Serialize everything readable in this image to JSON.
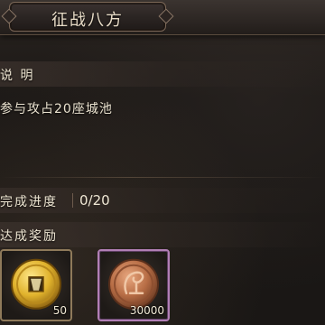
{
  "panel": {
    "title": "征战八方"
  },
  "section_desc": {
    "label": "说 明",
    "text": "参与攻占20座城池"
  },
  "progress": {
    "label": "完成进度",
    "value": "0/20"
  },
  "rewards": {
    "label": "达成奖励",
    "items": [
      {
        "icon": "gold-coin-icon",
        "quantity": "50",
        "frame_color": "#8f7a5a"
      },
      {
        "icon": "copper-coin-icon",
        "quantity": "30000",
        "frame_color": "#b27fb6"
      }
    ]
  }
}
